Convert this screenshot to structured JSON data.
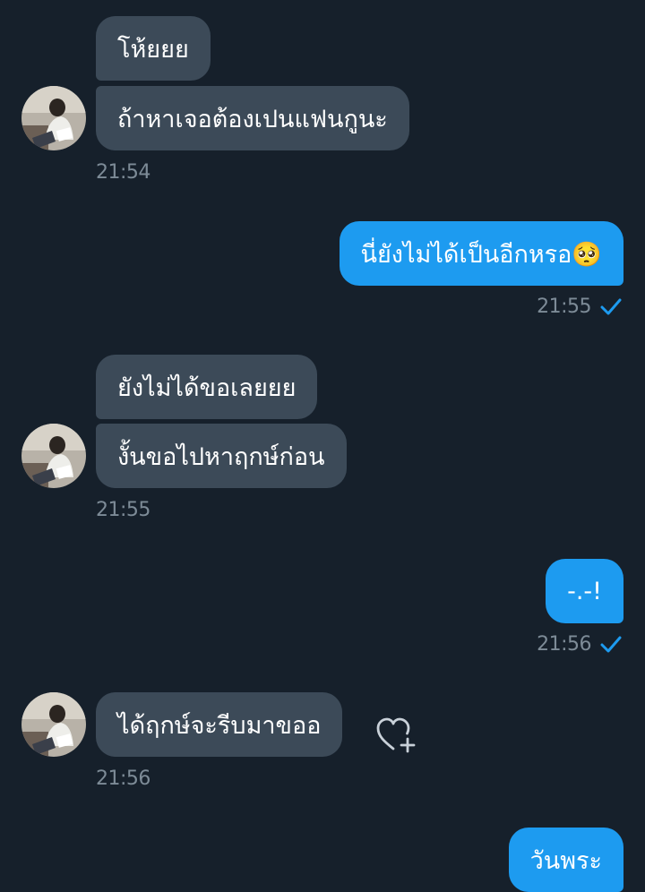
{
  "conversation": {
    "messages": [
      {
        "side": "in",
        "text": "โห้ยยย"
      },
      {
        "side": "in",
        "text": "ถ้าหาเจอต้องเปนแฟนกูนะ",
        "time": "21:54"
      },
      {
        "side": "out",
        "text": "นี่ยังไม่ได้เป็นอีกหรอ🥺",
        "time": "21:55",
        "status": "sent"
      },
      {
        "side": "in",
        "text": "ยังไม่ได้ขอเลยยย"
      },
      {
        "side": "in",
        "text": "งั้นขอไปหาฤกษ์ก่อน",
        "time": "21:55"
      },
      {
        "side": "out",
        "text": "-.-!",
        "time": "21:56",
        "status": "sent"
      },
      {
        "side": "in",
        "text": "ได้ฤกษ์จะรีบมาขออ",
        "time": "21:56"
      },
      {
        "side": "out",
        "text": "วันพระ"
      }
    ]
  },
  "icons": {
    "check": "check-icon",
    "reaction": "heart-plus-icon",
    "avatar": "contact-avatar"
  },
  "colors": {
    "background": "#16202b",
    "incoming_bubble": "#3c4a58",
    "outgoing_bubble": "#1d9bf0",
    "timestamp": "#7d8b97",
    "check": "#1d9bf0"
  }
}
